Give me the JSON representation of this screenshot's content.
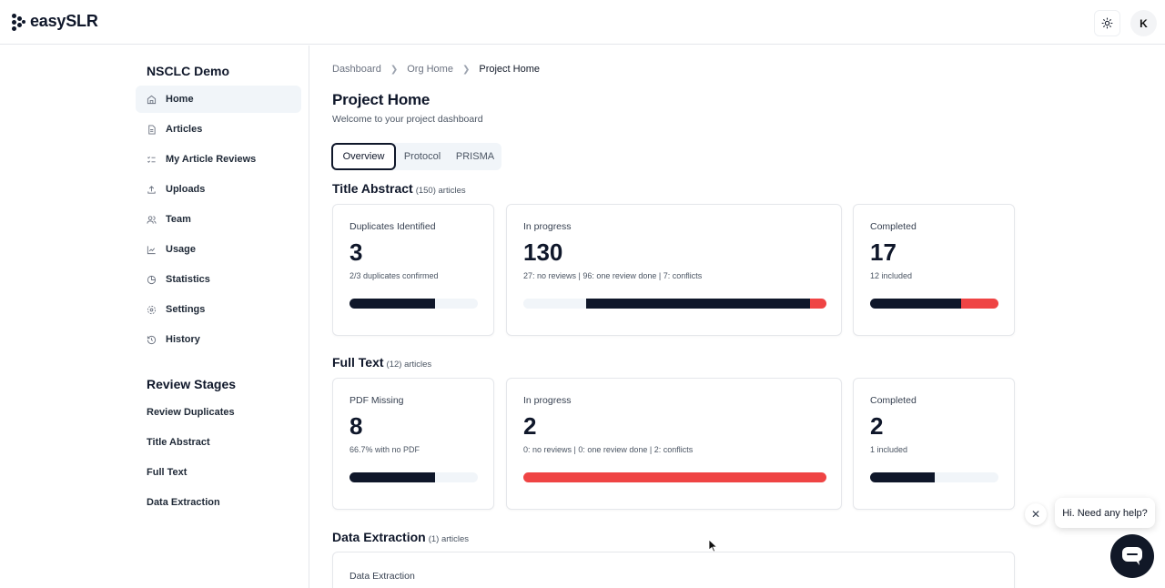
{
  "app": {
    "name": "easySLR"
  },
  "header": {
    "avatar_initial": "K"
  },
  "sidebar": {
    "project_title": "NSCLC Demo",
    "items": [
      {
        "label": "Home",
        "icon": "home-icon",
        "active": true
      },
      {
        "label": "Articles",
        "icon": "file-text-icon",
        "active": false
      },
      {
        "label": "My Article Reviews",
        "icon": "list-checks-icon",
        "active": false
      },
      {
        "label": "Uploads",
        "icon": "upload-icon",
        "active": false
      },
      {
        "label": "Team",
        "icon": "users-icon",
        "active": false
      },
      {
        "label": "Usage",
        "icon": "line-chart-icon",
        "active": false
      },
      {
        "label": "Statistics",
        "icon": "pie-chart-icon",
        "active": false
      },
      {
        "label": "Settings",
        "icon": "gear-icon",
        "active": false
      },
      {
        "label": "History",
        "icon": "history-icon",
        "active": false
      }
    ],
    "stages_title": "Review Stages",
    "stages": [
      "Review Duplicates",
      "Title Abstract",
      "Full Text",
      "Data Extraction"
    ]
  },
  "breadcrumb": [
    "Dashboard",
    "Org Home",
    "Project Home"
  ],
  "page": {
    "title": "Project Home",
    "subtitle": "Welcome to your project dashboard"
  },
  "tabs": [
    "Overview",
    "Protocol",
    "PRISMA"
  ],
  "sections": {
    "title_abstract": {
      "title": "Title Abstract",
      "count": "(150) articles",
      "cards": [
        {
          "label": "Duplicates Identified",
          "value": "3",
          "sub": "2/3 duplicates confirmed",
          "progress": 0.67
        },
        {
          "label": "In progress",
          "value": "130",
          "sub": "27: no reviews | 96: one review done | 7: conflicts",
          "segments": [
            27,
            96,
            7
          ]
        },
        {
          "label": "Completed",
          "value": "17",
          "sub": "12 included",
          "segments": [
            12,
            5
          ]
        }
      ]
    },
    "full_text": {
      "title": "Full Text",
      "count": "(12) articles",
      "cards": [
        {
          "label": "PDF Missing",
          "value": "8",
          "sub": "66.7% with no PDF",
          "progress": 0.667
        },
        {
          "label": "In progress",
          "value": "2",
          "sub": "0: no reviews | 0: one review done | 2: conflicts",
          "segments": [
            0,
            0,
            2
          ]
        },
        {
          "label": "Completed",
          "value": "2",
          "sub": "1 included",
          "progress": 0.5
        }
      ]
    },
    "data_extraction": {
      "title": "Data Extraction",
      "count": "(1) articles",
      "card_label": "Data Extraction"
    }
  },
  "help": {
    "bubble": "Hi. Need any help?"
  },
  "colors": {
    "dark": "#0f172a",
    "red": "#ef4444",
    "track": "#f1f5f9"
  }
}
